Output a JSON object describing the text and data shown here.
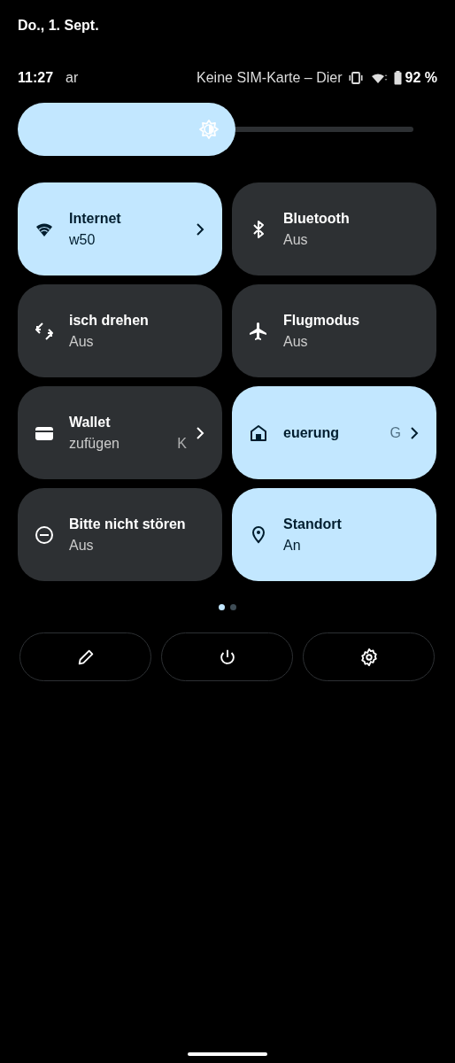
{
  "date": "Do., 1. Sept.",
  "status_bar": {
    "time": "11:27",
    "carrier_fragment": "ar",
    "network": "Keine SIM-Karte – Dier",
    "battery": "92 %"
  },
  "brightness": {
    "level": 0.55
  },
  "tiles": [
    {
      "kind": "wifi",
      "title": "Internet",
      "subtitle": "w50",
      "on": true,
      "chevron": true
    },
    {
      "kind": "bluetooth",
      "title": "Bluetooth",
      "subtitle": "Aus",
      "on": false,
      "chevron": false
    },
    {
      "kind": "rotate",
      "title": "isch drehen",
      "subtitle": "Aus",
      "on": false,
      "chevron": false
    },
    {
      "kind": "airplane",
      "title": "Flugmodus",
      "subtitle": "Aus",
      "on": false,
      "chevron": false
    },
    {
      "kind": "wallet",
      "title": "Wallet",
      "subtitle": "zufügen",
      "subtitle_extra": "K",
      "on": false,
      "chevron": true
    },
    {
      "kind": "home",
      "title": "euerung",
      "title_extra": "G",
      "on": true,
      "chevron": true
    },
    {
      "kind": "dnd",
      "title": "Bitte nicht stören",
      "subtitle": "Aus",
      "on": false,
      "chevron": false
    },
    {
      "kind": "location",
      "title": "Standort",
      "subtitle": "An",
      "on": true,
      "chevron": false
    }
  ],
  "pages": [
    {
      "selected": true
    },
    {
      "selected": false
    }
  ],
  "buttons": [
    {
      "kind": "edit"
    },
    {
      "kind": "power"
    },
    {
      "kind": "settings"
    }
  ]
}
